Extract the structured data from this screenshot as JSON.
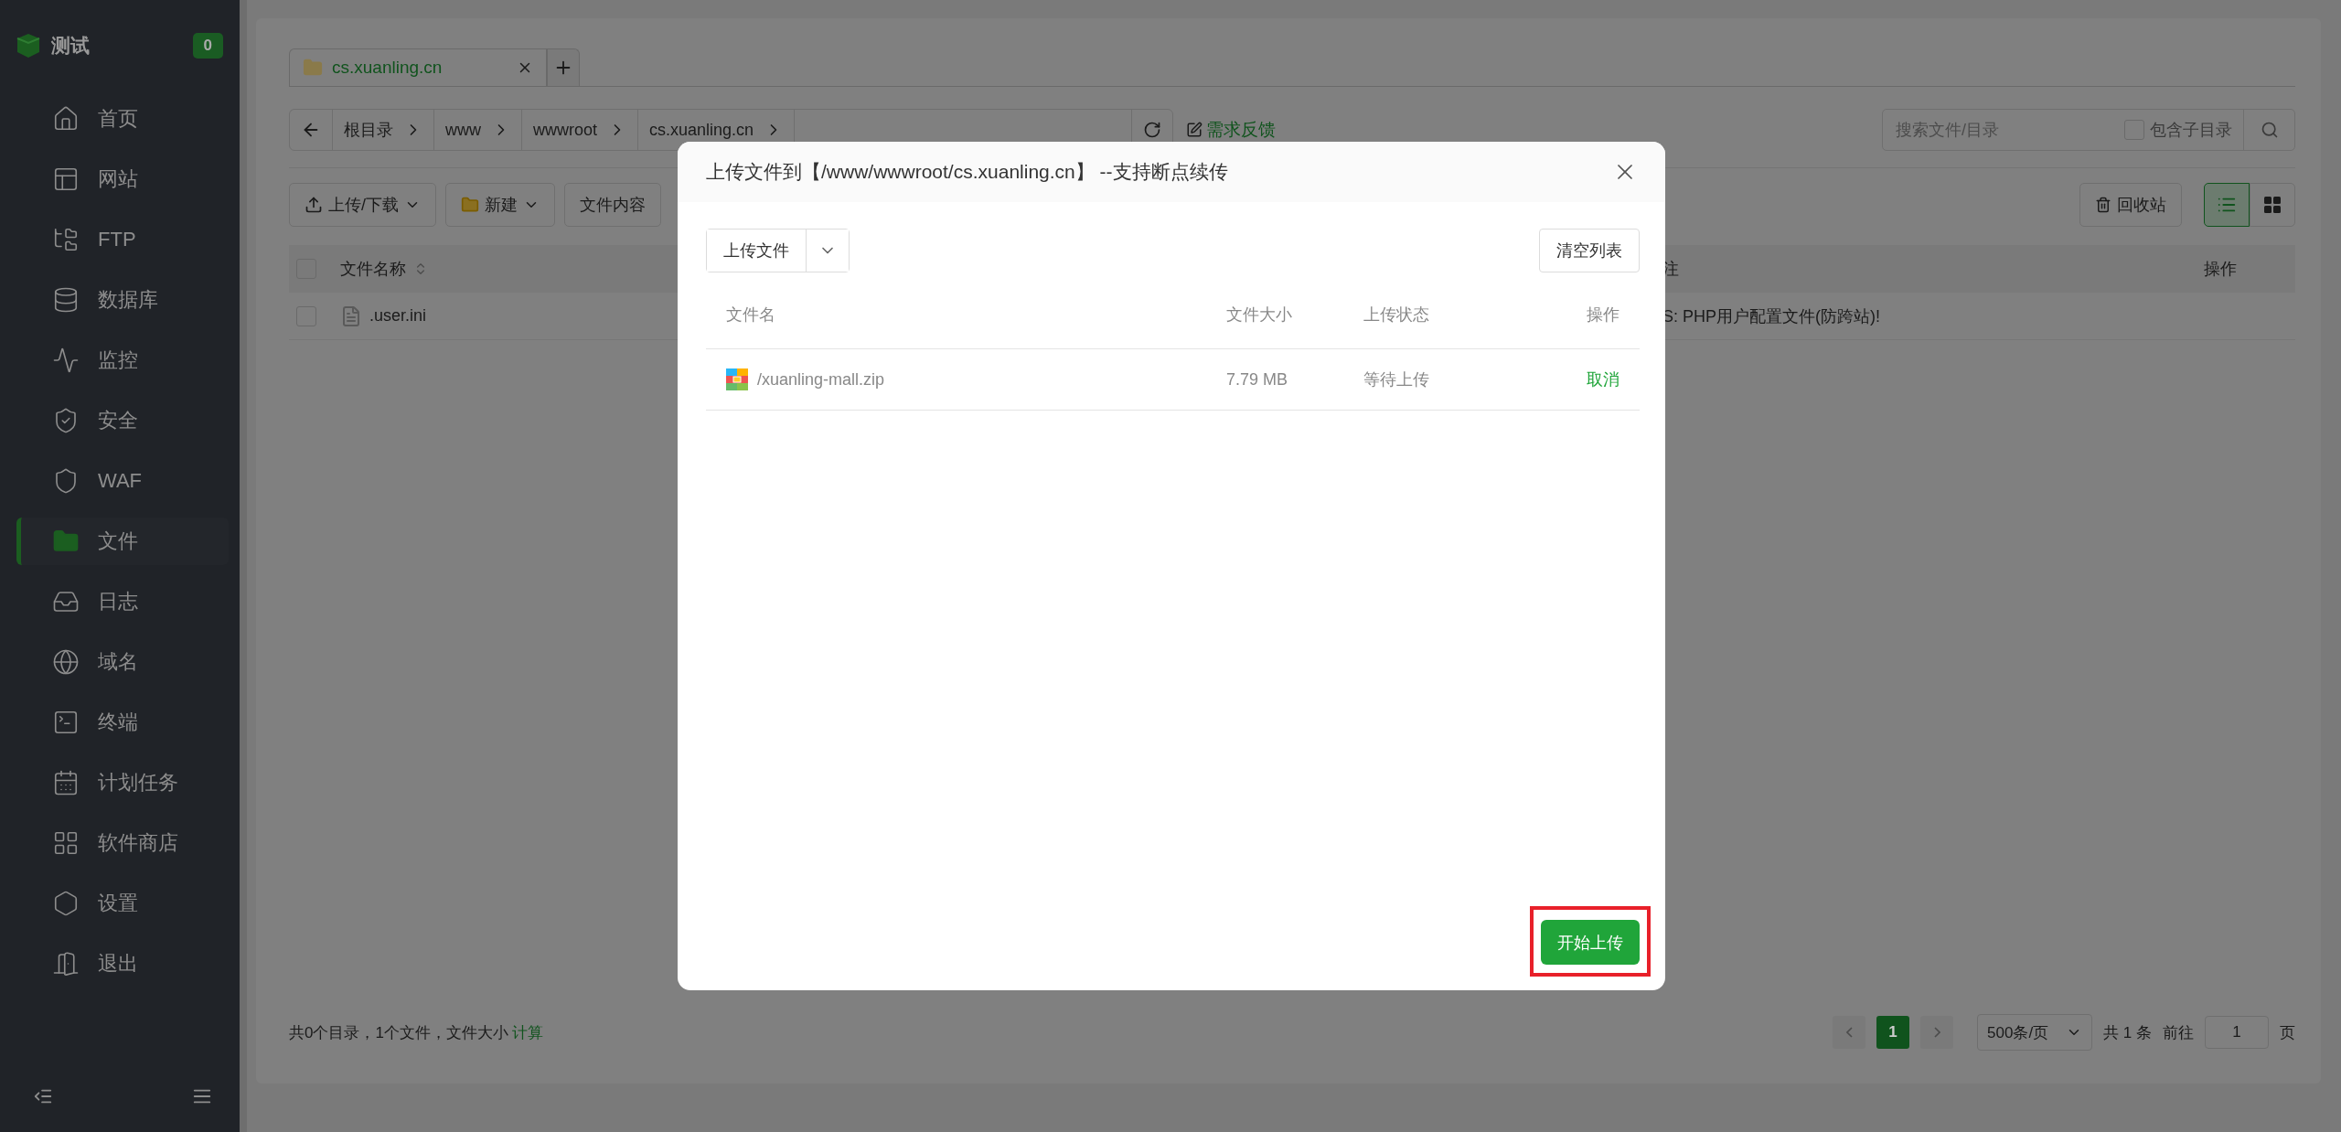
{
  "sidebar": {
    "brand": "测试",
    "badge": "0",
    "items": [
      {
        "kind": "home",
        "label": "首页",
        "selected": false
      },
      {
        "kind": "site",
        "label": "网站",
        "selected": false
      },
      {
        "kind": "ftp",
        "label": "FTP",
        "selected": false
      },
      {
        "kind": "database",
        "label": "数据库",
        "selected": false
      },
      {
        "kind": "monitor",
        "label": "监控",
        "selected": false
      },
      {
        "kind": "security",
        "label": "安全",
        "selected": false
      },
      {
        "kind": "waf",
        "label": "WAF",
        "selected": false
      },
      {
        "kind": "files",
        "label": "文件",
        "selected": true
      },
      {
        "kind": "logs",
        "label": "日志",
        "selected": false
      },
      {
        "kind": "domain",
        "label": "域名",
        "selected": false
      },
      {
        "kind": "terminal",
        "label": "终端",
        "selected": false
      },
      {
        "kind": "cron",
        "label": "计划任务",
        "selected": false
      },
      {
        "kind": "store",
        "label": "软件商店",
        "selected": false
      },
      {
        "kind": "settings",
        "label": "设置",
        "selected": false
      },
      {
        "kind": "logout",
        "label": "退出",
        "selected": false
      }
    ]
  },
  "tabs": [
    {
      "label": "cs.xuanling.cn",
      "selected": true
    }
  ],
  "breadcrumb": [
    "根目录",
    "www",
    "wwwroot",
    "cs.xuanling.cn"
  ],
  "feedback_link": "需求反馈",
  "search": {
    "placeholder": "搜索文件/目录",
    "subdir_label": "包含子目录",
    "subdir_checked": false
  },
  "toolbar": [
    "上传/下载",
    "新建",
    "文件内容"
  ],
  "recycle_bin": "回收站",
  "view_modes": [
    {
      "kind": "list",
      "selected": true
    },
    {
      "kind": "grid",
      "selected": false
    }
  ],
  "table": {
    "all_checked": false,
    "columns": [
      "文件名称",
      "注",
      "操作"
    ],
    "rows": [
      {
        "name": ".user.ini",
        "note": "S: PHP用户配置文件(防跨站)!",
        "checked": false
      }
    ]
  },
  "footer": {
    "summary": "共0个目录，1个文件，文件大小",
    "calc_link": "计算",
    "pages": [
      {
        "label": "1",
        "selected": true
      }
    ],
    "page_size": "500条/页",
    "total": "共 1 条",
    "goto_label": "前往",
    "goto_value": "1",
    "page_unit": "页"
  },
  "dialog": {
    "title": "上传文件到【/www/wwwroot/cs.xuanling.cn】 --支持断点续传",
    "upload_button": "上传文件",
    "clear_button": "清空列表",
    "columns": [
      "文件名",
      "文件大小",
      "上传状态",
      "操作"
    ],
    "rows": [
      {
        "name": "/xuanling-mall.zip",
        "size": "7.79 MB",
        "status": "等待上传",
        "action": "取消"
      }
    ],
    "start_button": "开始上传",
    "start_highlighted": true
  }
}
